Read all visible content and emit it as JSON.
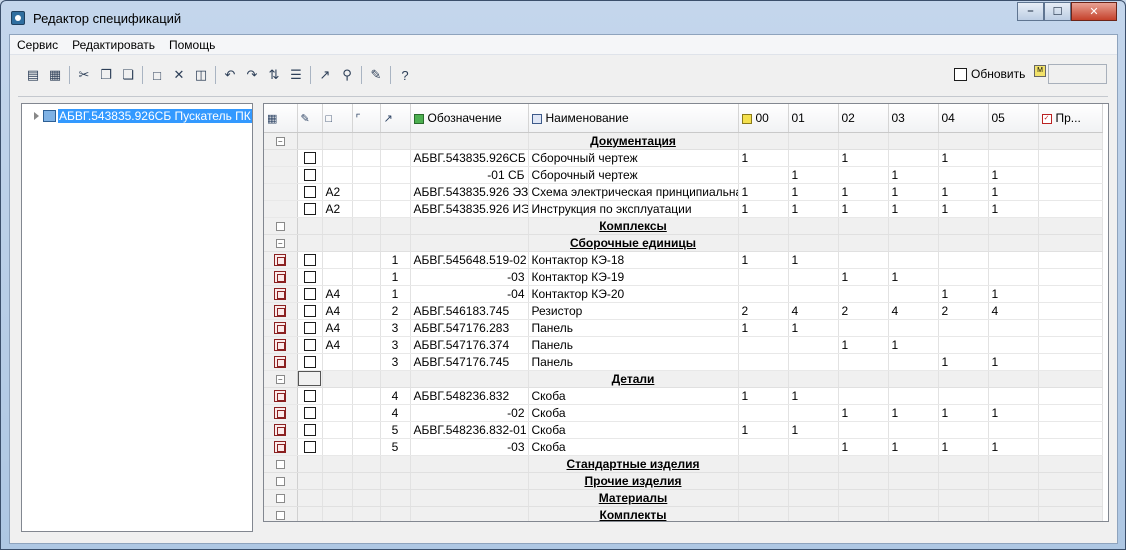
{
  "window": {
    "title": "Редактор спецификаций"
  },
  "menu": [
    "Сервис",
    "Редактировать",
    "Помощь"
  ],
  "toolbar": {
    "refresh_label": "Обновить",
    "m_icon": "M"
  },
  "tree": {
    "root_label": "АБВГ.543835.926СБ Пускатель ПК"
  },
  "columns": {
    "designation": "Обозначение",
    "name": "Наименование",
    "v00": "00",
    "v01": "01",
    "v02": "02",
    "v03": "03",
    "v04": "04",
    "v05": "05",
    "extra": "Пр..."
  },
  "sections": [
    {
      "title": "Документация",
      "expanded": true,
      "rows": [
        {
          "icon": false,
          "format": "",
          "pos": "",
          "designation": "АБВГ.543835.926СБ",
          "name": "Сборочный чертеж",
          "v": [
            "1",
            "",
            "1",
            "",
            "1",
            ""
          ]
        },
        {
          "icon": false,
          "format": "",
          "pos": "",
          "designation": "-01 СБ",
          "name": "Сборочный чертеж",
          "v": [
            "",
            "1",
            "",
            "1",
            "",
            "1"
          ]
        },
        {
          "icon": false,
          "format": "A2",
          "pos": "",
          "designation": "АБВГ.543835.926 ЭЗ",
          "name": "Схема электрическая принципиальная",
          "v": [
            "1",
            "1",
            "1",
            "1",
            "1",
            "1"
          ]
        },
        {
          "icon": false,
          "format": "A2",
          "pos": "",
          "designation": "АБВГ.543835.926 ИЭ",
          "name": "Инструкция по эксплуатации",
          "v": [
            "1",
            "1",
            "1",
            "1",
            "1",
            "1"
          ]
        }
      ]
    },
    {
      "title": "Комплексы",
      "expanded": false,
      "rows": []
    },
    {
      "title": "Сборочные единицы",
      "expanded": true,
      "rows": [
        {
          "icon": true,
          "format": "",
          "pos": "1",
          "designation": "АБВГ.545648.519-02",
          "name": "Контактор КЭ-18",
          "v": [
            "1",
            "1",
            "",
            "",
            "",
            ""
          ]
        },
        {
          "icon": true,
          "format": "",
          "pos": "1",
          "designation": "-03",
          "name": "Контактор КЭ-19",
          "v": [
            "",
            "",
            "1",
            "1",
            "",
            ""
          ]
        },
        {
          "icon": true,
          "format": "A4",
          "pos": "1",
          "designation": "-04",
          "name": "Контактор КЭ-20",
          "v": [
            "",
            "",
            "",
            "",
            "1",
            "1"
          ]
        },
        {
          "icon": true,
          "format": "A4",
          "pos": "2",
          "designation": "АБВГ.546183.745",
          "name": "Резистор",
          "v": [
            "2",
            "4",
            "2",
            "4",
            "2",
            "4"
          ]
        },
        {
          "icon": true,
          "format": "A4",
          "pos": "3",
          "designation": "АБВГ.547176.283",
          "name": "Панель",
          "v": [
            "1",
            "1",
            "",
            "",
            "",
            ""
          ]
        },
        {
          "icon": true,
          "format": "A4",
          "pos": "3",
          "designation": "АБВГ.547176.374",
          "name": "Панель",
          "v": [
            "",
            "",
            "1",
            "1",
            "",
            ""
          ]
        },
        {
          "icon": true,
          "format": "",
          "pos": "3",
          "designation": "АБВГ.547176.745",
          "name": "Панель",
          "v": [
            "",
            "",
            "",
            "",
            "1",
            "1"
          ]
        }
      ]
    },
    {
      "title": "Детали",
      "expanded": true,
      "rows": [
        {
          "icon": true,
          "format": "",
          "pos": "4",
          "designation": "АБВГ.548236.832",
          "name": "Скоба",
          "v": [
            "1",
            "1",
            "",
            "",
            "",
            ""
          ]
        },
        {
          "icon": true,
          "format": "",
          "pos": "4",
          "designation": "-02",
          "name": "Скоба",
          "v": [
            "",
            "",
            "1",
            "1",
            "1",
            "1"
          ]
        },
        {
          "icon": true,
          "format": "",
          "pos": "5",
          "designation": "АБВГ.548236.832-01",
          "name": "Скоба",
          "v": [
            "1",
            "1",
            "",
            "",
            "",
            ""
          ]
        },
        {
          "icon": true,
          "format": "",
          "pos": "5",
          "designation": "-03",
          "name": "Скоба",
          "v": [
            "",
            "",
            "1",
            "1",
            "1",
            "1"
          ]
        }
      ]
    },
    {
      "title": "Стандартные изделия",
      "expanded": false,
      "rows": []
    },
    {
      "title": "Прочие изделия",
      "expanded": false,
      "rows": []
    },
    {
      "title": "Материалы",
      "expanded": false,
      "rows": []
    },
    {
      "title": "Комплекты",
      "expanded": false,
      "rows": []
    }
  ]
}
